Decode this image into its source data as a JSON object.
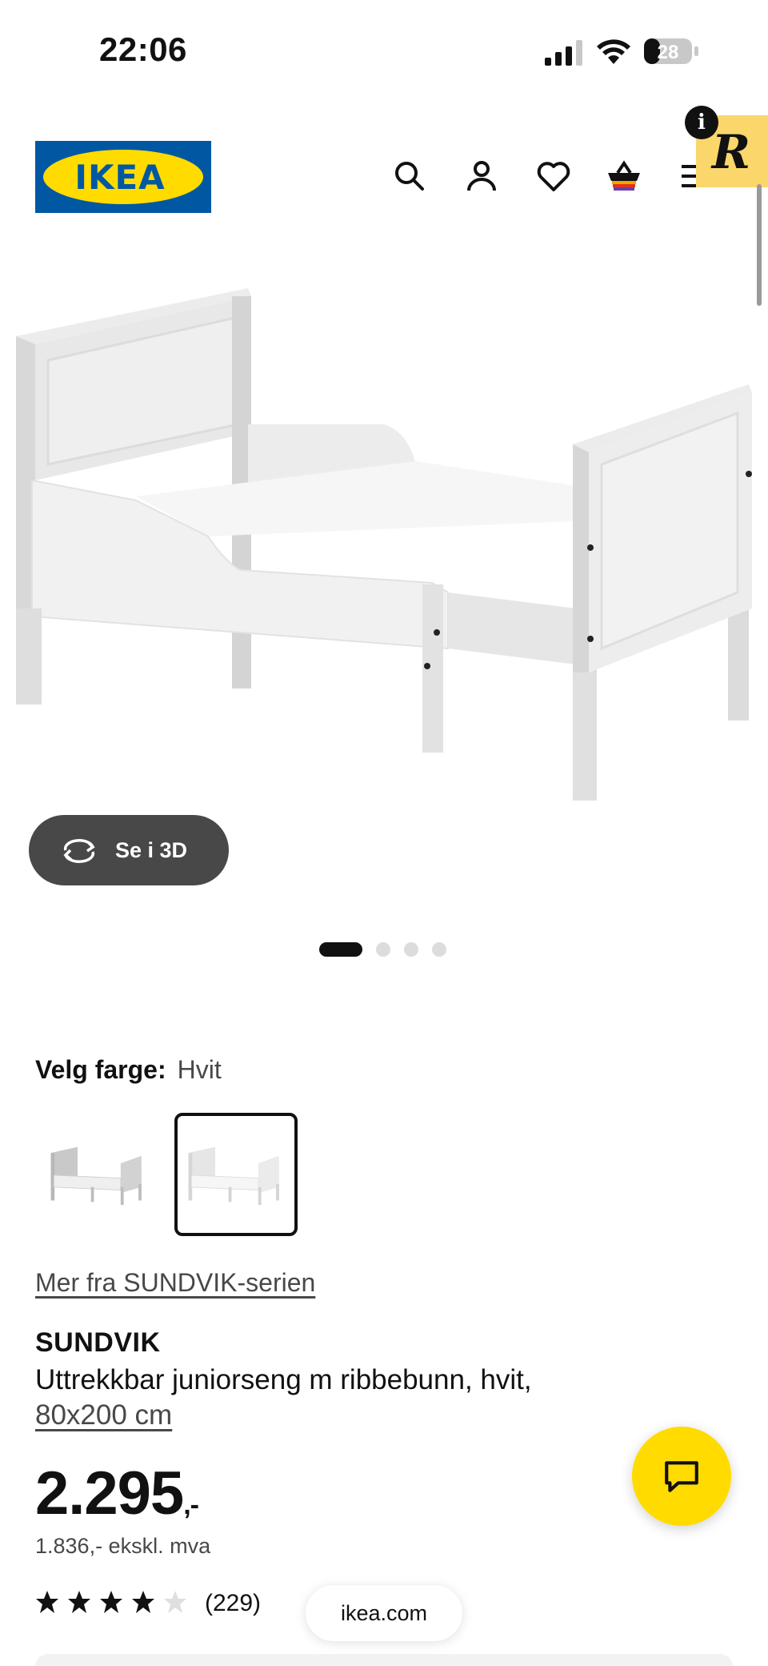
{
  "status_bar": {
    "time": "22:06",
    "battery": "28"
  },
  "header": {
    "logo_text": "IKEA",
    "brand_colors": {
      "blue": "#0058a3",
      "yellow": "#ffdb00"
    },
    "icons": [
      "search-icon",
      "account-icon",
      "heart-icon",
      "basket-icon",
      "menu-icon"
    ],
    "extension_badge_letter": "R",
    "info_badge": "i"
  },
  "gallery": {
    "view_3d_label": "Se i 3D",
    "slide_count": 4,
    "active_slide": 1
  },
  "color_selector": {
    "label": "Velg farge:",
    "value": "Hvit",
    "options": [
      "grey-white bed",
      "white bed"
    ],
    "selected_index": 1
  },
  "product": {
    "series_link": "Mer fra SUNDVIK-serien",
    "name": "SUNDVIK",
    "description": "Uttrekkbar juniorseng m ribbebunn, hvit,",
    "size": "80x200 cm",
    "price": "2.295",
    "price_suffix": ",-",
    "price_ex_vat": "1.836,- ekskl. mva",
    "rating": 4,
    "rating_max": 5,
    "review_count": "(229)"
  },
  "browser": {
    "url": "ikea.com"
  },
  "chat": {
    "icon": "chat-icon"
  }
}
